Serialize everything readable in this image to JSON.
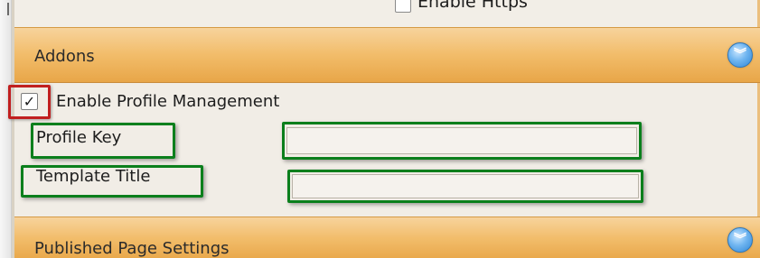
{
  "top_row": {
    "https_label": "Enable Https",
    "https_checked": false
  },
  "addons": {
    "title": "Addons",
    "collapse_icon": "double-chevron-up",
    "enable_profile_management": {
      "label": "Enable Profile Management",
      "checked": true,
      "check_glyph": "✓"
    },
    "fields": [
      {
        "label": "Profile Key",
        "value": "",
        "placeholder": ""
      },
      {
        "label": "Template Title",
        "value": "",
        "placeholder": ""
      }
    ]
  },
  "published_page_settings": {
    "title": "Published Page Settings",
    "collapse_icon": "double-chevron-down"
  },
  "icons": {
    "collapse_glyph": "︾"
  },
  "colors": {
    "header_orange": "#f2bd6b",
    "panel_bg": "#f2eee7",
    "highlight_red": "#c11f1f",
    "highlight_green": "#0b7f1c",
    "button_blue": "#2f86d6"
  }
}
